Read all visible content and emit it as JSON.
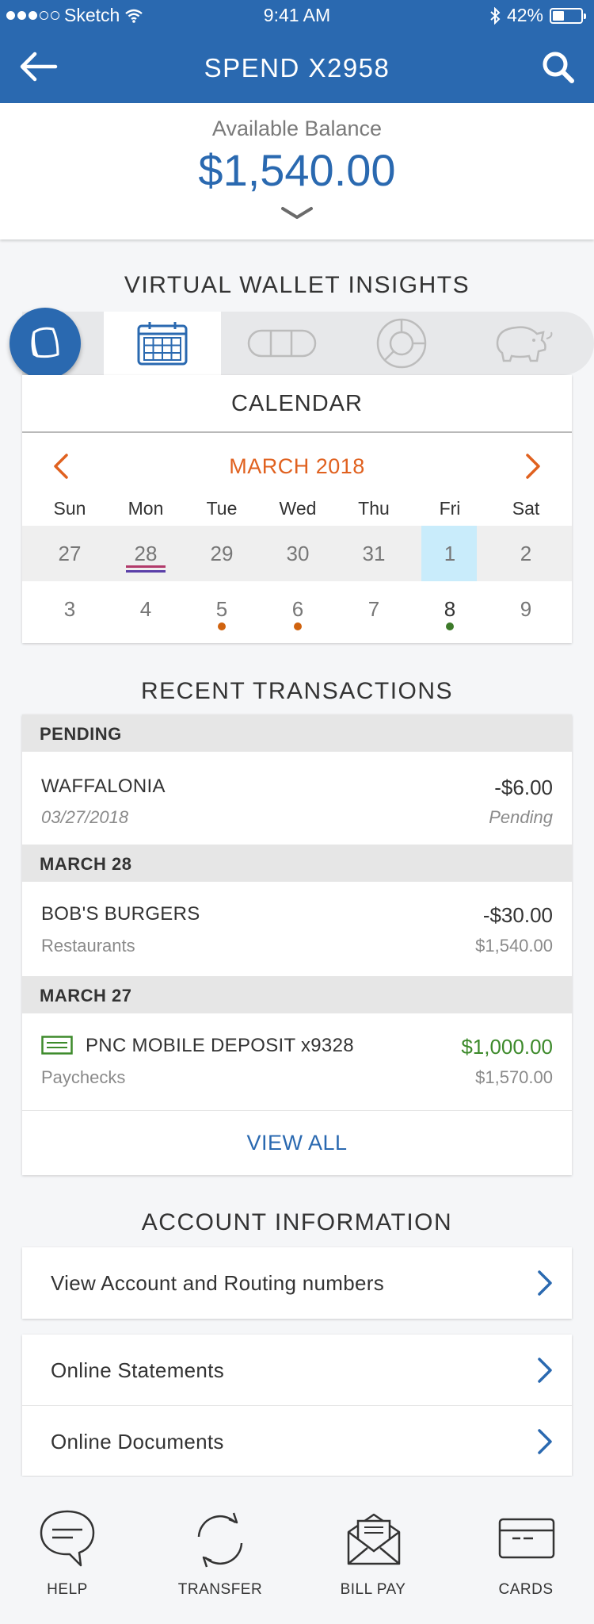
{
  "status_bar": {
    "carrier": "Sketch",
    "time": "9:41 AM",
    "battery": "42%",
    "battery_level": 0.42
  },
  "header": {
    "title": "SPEND X2958"
  },
  "balance": {
    "label": "Available Balance",
    "amount": "$1,540.00"
  },
  "insights": {
    "title": "VIRTUAL WALLET INSIGHTS",
    "tabs": [
      "calendar-icon",
      "pill-toggle-icon",
      "donut-chart-icon",
      "piggy-bank-icon"
    ],
    "active_tab": "calendar"
  },
  "calendar": {
    "header": "CALENDAR",
    "month": "MARCH 2018",
    "weekdays": [
      "Sun",
      "Mon",
      "Tue",
      "Wed",
      "Thu",
      "Fri",
      "Sat"
    ],
    "week1": [
      "27",
      "28",
      "29",
      "30",
      "31",
      "1",
      "2"
    ],
    "week2": [
      "3",
      "4",
      "5",
      "6",
      "7",
      "8",
      "9"
    ],
    "selected_day": "1",
    "today": "8",
    "accent_color": "#e0611f",
    "dot_orange": "#d0630f",
    "dot_green": "#3d7a2a"
  },
  "transactions": {
    "title": "RECENT TRANSACTIONS",
    "groups": [
      {
        "header": "PENDING",
        "items": [
          {
            "name": "WAFFALONIA",
            "sub": "03/27/2018",
            "amount": "-$6.00",
            "balance": "Pending"
          }
        ]
      },
      {
        "header": "MARCH 28",
        "items": [
          {
            "name": "BOB'S BURGERS",
            "sub": "Restaurants",
            "amount": "-$30.00",
            "balance": "$1,540.00"
          }
        ]
      },
      {
        "header": "MARCH 27",
        "items": [
          {
            "name": "PNC MOBILE DEPOSIT x9328",
            "sub": "Paychecks",
            "amount": "$1,000.00",
            "balance": "$1,570.00",
            "icon": "check-deposit-icon"
          }
        ]
      }
    ],
    "view_all": "VIEW ALL",
    "deposit_color": "#3d8a2b"
  },
  "account_info": {
    "title": "ACCOUNT INFORMATION",
    "routing": "View Account and Routing numbers",
    "statements": "Online Statements",
    "documents": "Online Documents"
  },
  "tab_bar": {
    "help": "HELP",
    "transfer": "TRANSFER",
    "bill_pay": "BILL PAY",
    "cards": "CARDS"
  },
  "colors": {
    "brand": "#2a69b0",
    "background": "#f5f6f8"
  }
}
